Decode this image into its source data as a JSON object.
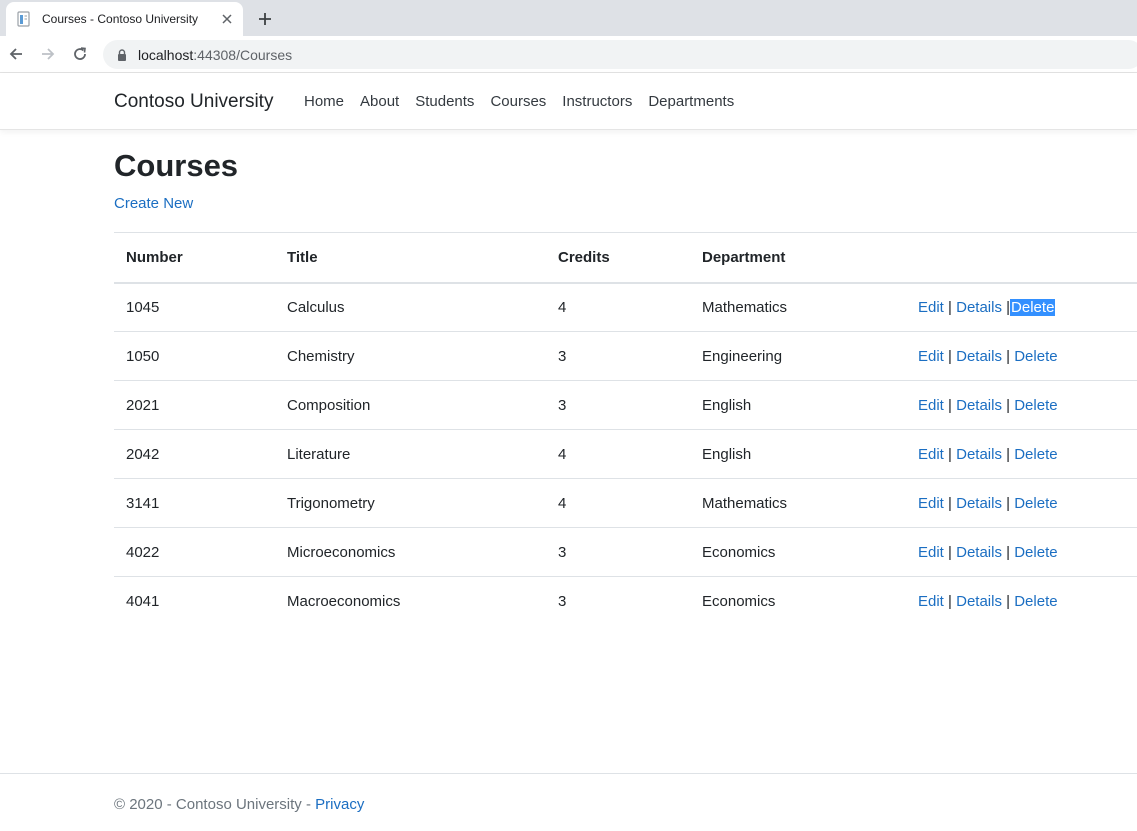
{
  "browser": {
    "tab_title": "Courses - Contoso University",
    "url_host": "localhost",
    "url_path": ":44308/Courses"
  },
  "navbar": {
    "brand": "Contoso University",
    "links": [
      "Home",
      "About",
      "Students",
      "Courses",
      "Instructors",
      "Departments"
    ]
  },
  "main": {
    "title": "Courses",
    "create_new": "Create New",
    "table": {
      "headers": [
        "Number",
        "Title",
        "Credits",
        "Department"
      ],
      "rows": [
        {
          "number": "1045",
          "title": "Calculus",
          "credits": "4",
          "department": "Mathematics"
        },
        {
          "number": "1050",
          "title": "Chemistry",
          "credits": "3",
          "department": "Engineering"
        },
        {
          "number": "2021",
          "title": "Composition",
          "credits": "3",
          "department": "English"
        },
        {
          "number": "2042",
          "title": "Literature",
          "credits": "4",
          "department": "English"
        },
        {
          "number": "3141",
          "title": "Trigonometry",
          "credits": "4",
          "department": "Mathematics"
        },
        {
          "number": "4022",
          "title": "Microeconomics",
          "credits": "3",
          "department": "Economics"
        },
        {
          "number": "4041",
          "title": "Macroeconomics",
          "credits": "3",
          "department": "Economics"
        }
      ],
      "actions": {
        "edit": "Edit",
        "details": "Details",
        "delete": "Delete",
        "separator": "|"
      },
      "selected_delete_row": 0
    }
  },
  "footer": {
    "text": "© 2020 - Contoso University - ",
    "privacy": "Privacy"
  },
  "colors": {
    "link": "#1b6ec2",
    "selection": "#3390ff"
  }
}
